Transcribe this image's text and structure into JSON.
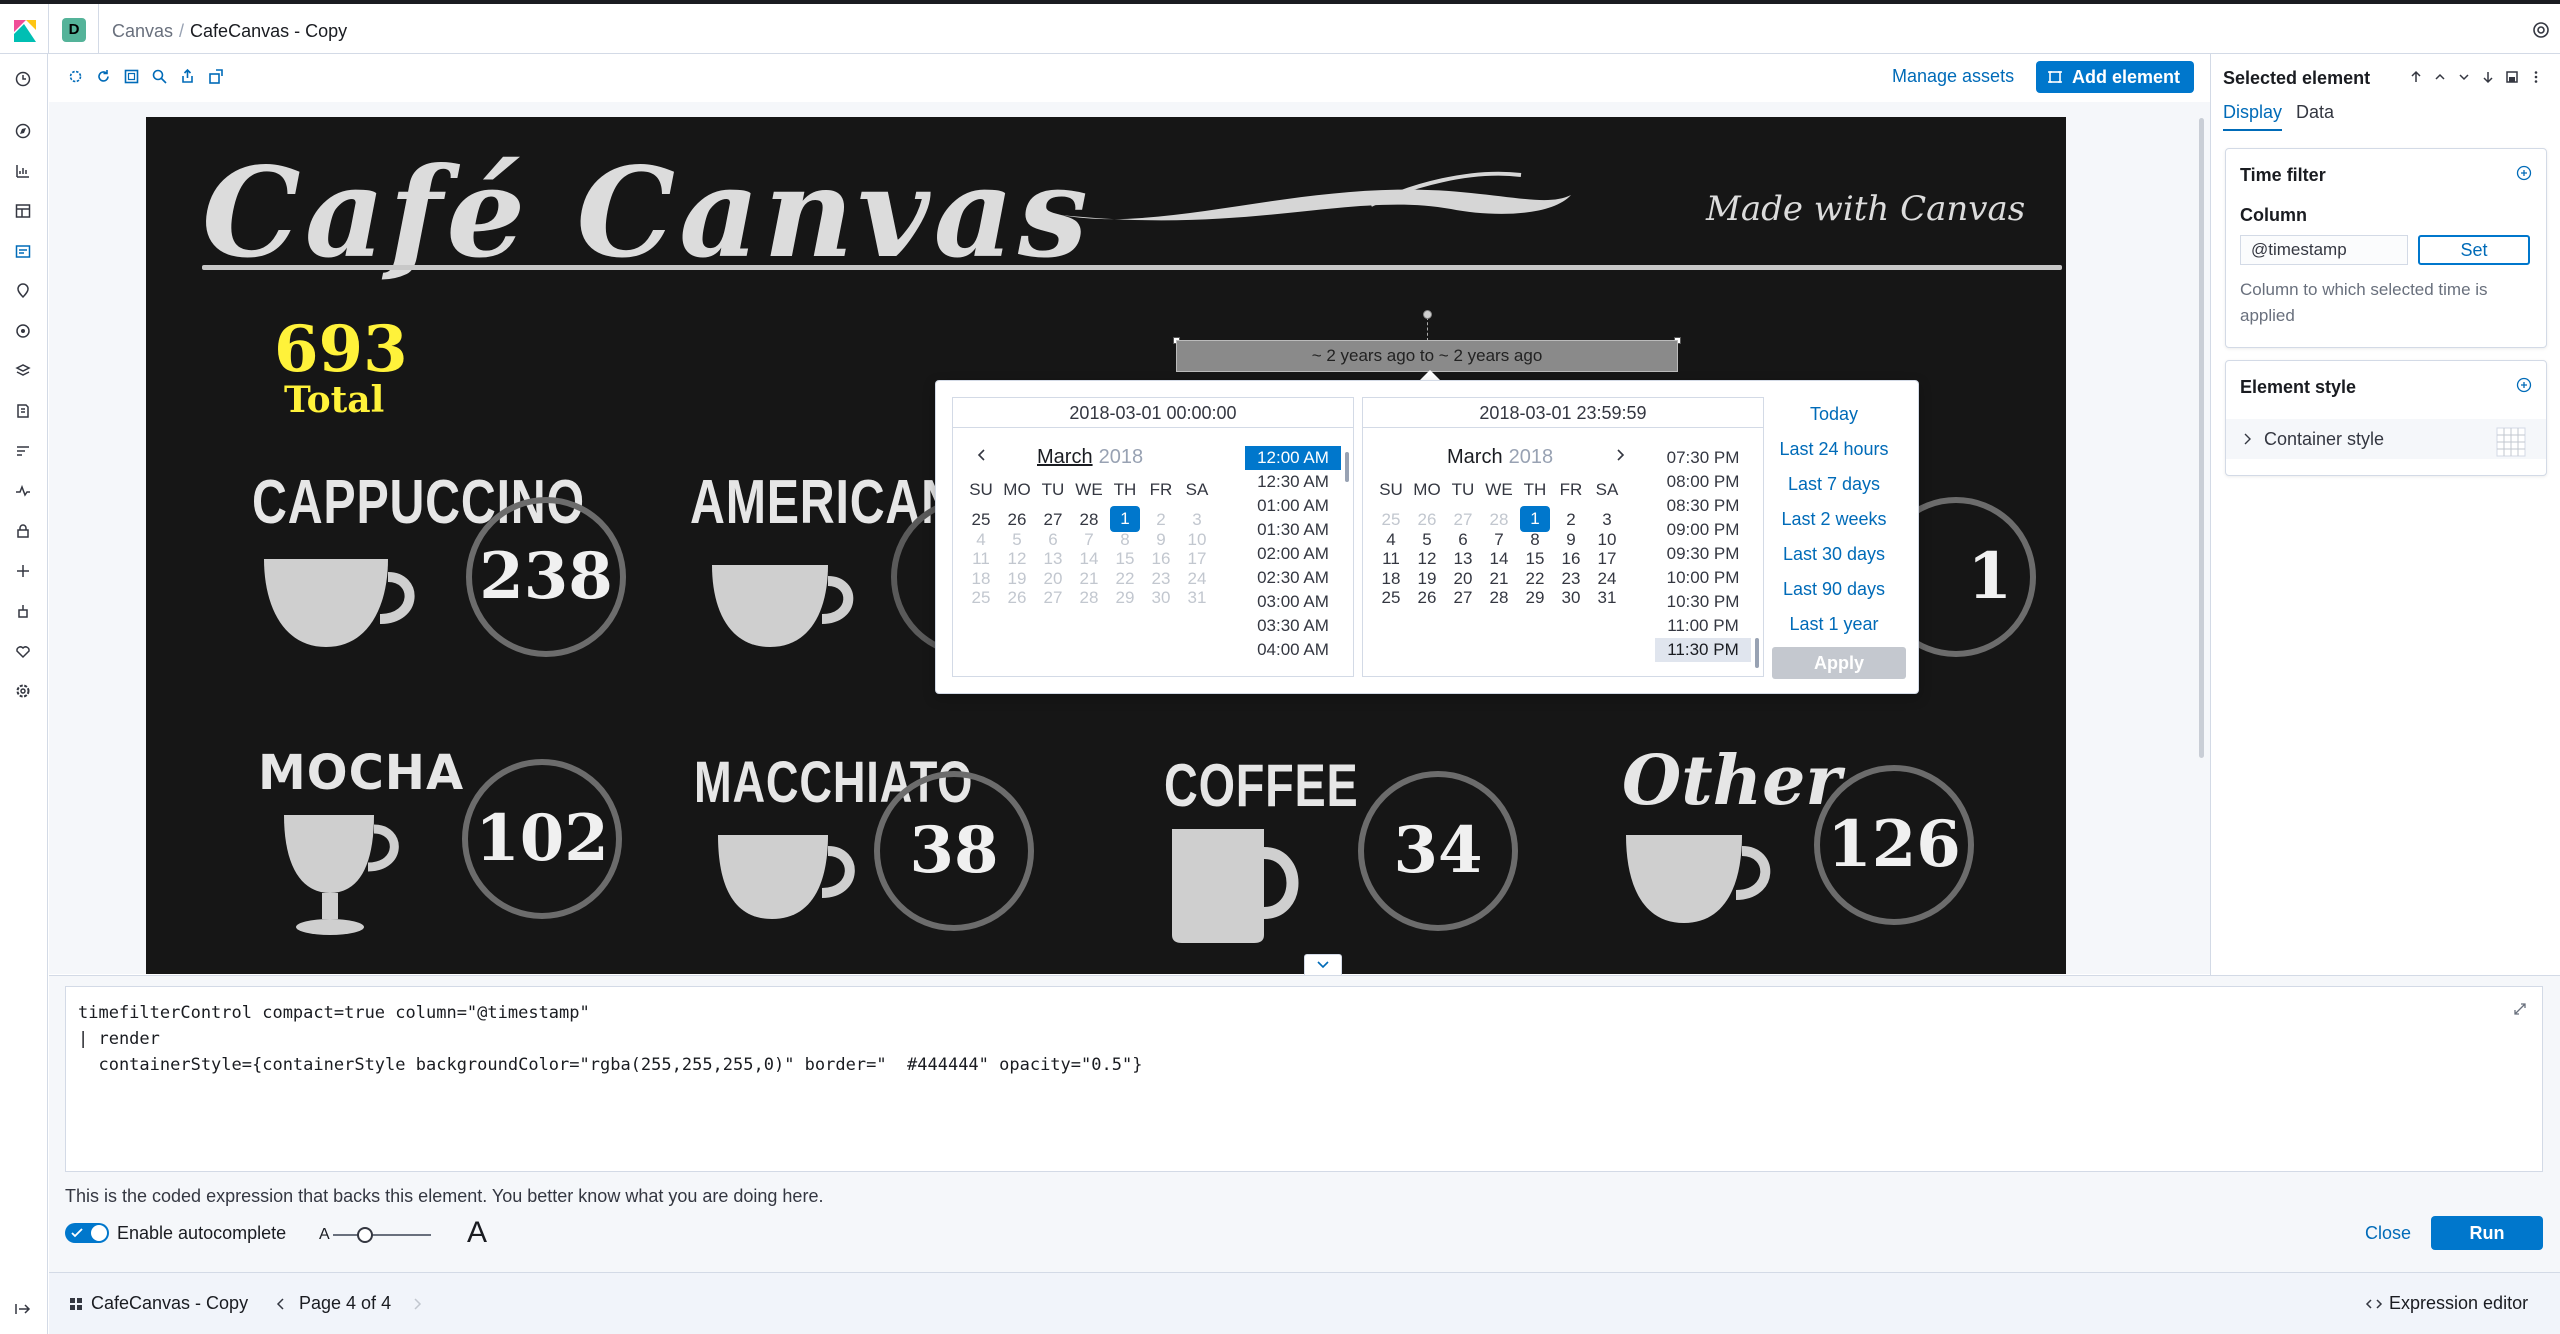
{
  "header": {
    "space_initial": "D",
    "breadcrumbs": [
      "Canvas",
      "CafeCanvas - Copy"
    ]
  },
  "toolbar": {
    "manage_assets": "Manage assets",
    "add_element": "Add element"
  },
  "workpad": {
    "title": "Café Canvas",
    "subtitle": "Made with Canvas",
    "total_value": "693",
    "total_label": "Total",
    "items": [
      {
        "name": "CAPPUCCINO",
        "count": "238"
      },
      {
        "name": "AMERICANO",
        "count": ""
      },
      {
        "name": "",
        "count": "1"
      },
      {
        "name": "MOCHA",
        "count": "102"
      },
      {
        "name": "MACCHIATO",
        "count": "38"
      },
      {
        "name": "COFFEE",
        "count": "34"
      },
      {
        "name": "Other",
        "count": "126"
      }
    ],
    "time_filter_text": "~ 2 years ago to ~ 2 years ago"
  },
  "date_picker": {
    "start_input": "2018-03-01 00:00:00",
    "end_input": "2018-03-01 23:59:59",
    "start_month": "March",
    "start_year": "2018",
    "end_month": "March",
    "end_year": "2018",
    "weekdays": [
      "SU",
      "MO",
      "TU",
      "WE",
      "TH",
      "FR",
      "SA"
    ],
    "start_days": [
      [
        "25",
        "26",
        "27",
        "28",
        "1",
        "2",
        "3"
      ],
      [
        "4",
        "5",
        "6",
        "7",
        "8",
        "9",
        "10"
      ],
      [
        "11",
        "12",
        "13",
        "14",
        "15",
        "16",
        "17"
      ],
      [
        "18",
        "19",
        "20",
        "21",
        "22",
        "23",
        "24"
      ],
      [
        "25",
        "26",
        "27",
        "28",
        "29",
        "30",
        "31"
      ]
    ],
    "end_days": [
      [
        "25",
        "26",
        "27",
        "28",
        "1",
        "2",
        "3"
      ],
      [
        "4",
        "5",
        "6",
        "7",
        "8",
        "9",
        "10"
      ],
      [
        "11",
        "12",
        "13",
        "14",
        "15",
        "16",
        "17"
      ],
      [
        "18",
        "19",
        "20",
        "21",
        "22",
        "23",
        "24"
      ],
      [
        "25",
        "26",
        "27",
        "28",
        "29",
        "30",
        "31"
      ]
    ],
    "start_times": [
      "12:00 AM",
      "12:30 AM",
      "01:00 AM",
      "01:30 AM",
      "02:00 AM",
      "02:30 AM",
      "03:00 AM",
      "03:30 AM",
      "04:00 AM"
    ],
    "end_times": [
      "07:30 PM",
      "08:00 PM",
      "08:30 PM",
      "09:00 PM",
      "09:30 PM",
      "10:00 PM",
      "10:30 PM",
      "11:00 PM",
      "11:30 PM"
    ],
    "quick_ranges": [
      "Today",
      "Last 24 hours",
      "Last 7 days",
      "Last 2 weeks",
      "Last 30 days",
      "Last 90 days",
      "Last 1 year"
    ],
    "apply": "Apply"
  },
  "right_panel": {
    "title": "Selected element",
    "tabs": [
      "Display",
      "Data"
    ],
    "time_filter": {
      "title": "Time filter",
      "column_label": "Column",
      "column_value": "@timestamp",
      "set_button": "Set",
      "help": "Column to which selected time is applied"
    },
    "element_style": {
      "title": "Element style",
      "container_style": "Container style"
    }
  },
  "expression": {
    "lines": [
      "timefilterControl compact=true column=\"@timestamp\"",
      "| render",
      "  containerStyle={containerStyle backgroundColor=\"rgba(255,255,255,0)\" border=\"  #444444\" opacity=\"0.5\"}"
    ],
    "help": "This is the coded expression that backs this element. You better know what you are doing here.",
    "autocomplete_label": "Enable autocomplete",
    "font_small": "A",
    "font_large": "A",
    "close": "Close",
    "run": "Run"
  },
  "footer": {
    "workpad_name": "CafeCanvas - Copy",
    "page": "Page 4 of 4",
    "expression_editor": "Expression editor"
  },
  "colors": {
    "primary": "#0077cc",
    "link": "#006bb8",
    "board_bg": "#161616",
    "total_yellow": "#fff23a"
  }
}
